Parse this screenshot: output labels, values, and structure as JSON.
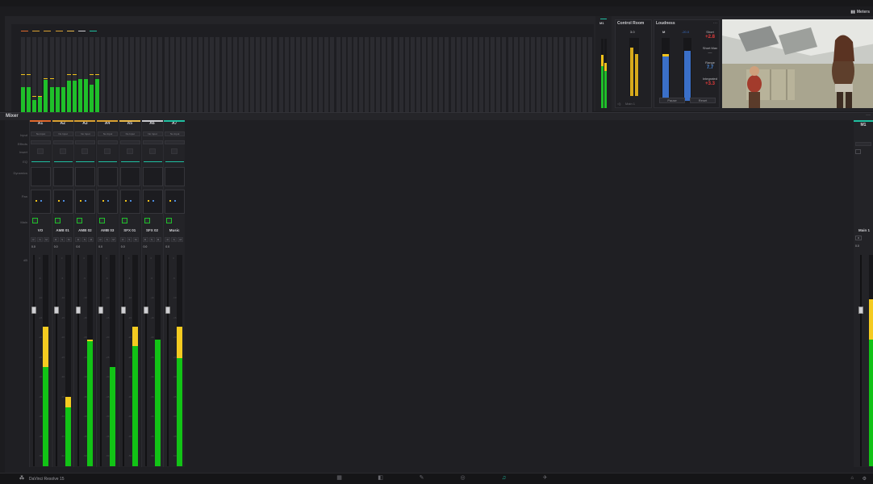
{
  "app": {
    "title": "DaVinci Resolve 15",
    "colors": {
      "meter_green": "#1fbf2a",
      "meter_yellow": "#f0c21a",
      "accent_blue": "#3a6fc8"
    }
  },
  "meters_panel": {
    "toggle_label": "Meters",
    "output_label": "M1",
    "control_room": {
      "title": "Control Room",
      "level": "3.0",
      "dim_label": "Main 1",
      "output_select": "MAIN 1"
    },
    "loudness": {
      "title": "Loudness",
      "m_label": "M",
      "target": "-20.0",
      "short_label": "Short",
      "short_value": "+2.8",
      "short_max_label": "Short Max",
      "short_max_value": "—",
      "range_label": "Range",
      "range_value": "7.7",
      "integrated_label": "Integrated",
      "integrated_value": "+3.3",
      "pause_label": "Pause",
      "reset_label": "Reset"
    }
  },
  "mixer": {
    "title": "Mixer",
    "menu_icon": "ellipsis-icon",
    "row_labels": {
      "input": "Input",
      "effects": "Effects",
      "insert": "Insert",
      "eq": "EQ",
      "dynamics": "Dynamics",
      "pan": "Pan",
      "main": "Main",
      "db": "dB"
    },
    "strips": [
      {
        "id": "A1",
        "name": "VO",
        "input": "No Input",
        "color": "#e0682b",
        "level": 0.47,
        "peak": 0.66,
        "level2": 0.47,
        "gain": "0.0"
      },
      {
        "id": "A2",
        "name": "AMB 01",
        "input": "No Input",
        "color": "#d9a031",
        "level": 0.28,
        "peak": 0.33,
        "level2": 0.33,
        "gain": "0.0"
      },
      {
        "id": "A3",
        "name": "AMB 02",
        "input": "No Input",
        "color": "#d9a031",
        "level": 0.59,
        "peak": 0.6,
        "level2": 0.48,
        "gain": "0.0"
      },
      {
        "id": "A4",
        "name": "AMB 03",
        "input": "No Input",
        "color": "#d9a031",
        "level": 0.47,
        "peak": 0.47,
        "level2": 0.47,
        "gain": "0.0"
      },
      {
        "id": "A5",
        "name": "SFX 01",
        "input": "No Input",
        "color": "#e8b84a",
        "level": 0.57,
        "peak": 0.66,
        "level2": 0.57,
        "gain": "0.0"
      },
      {
        "id": "A6",
        "name": "SFX 02",
        "input": "No Input",
        "color": "#c9c9cd",
        "level": 0.6,
        "peak": 0.6,
        "level2": 0.6,
        "gain": "0.0"
      },
      {
        "id": "A7",
        "name": "Music",
        "input": "No Input",
        "color": "#1fbfa0",
        "level": 0.51,
        "peak": 0.66,
        "level2": 0.6,
        "gain": "0.0"
      }
    ],
    "main_strip": {
      "id": "M1",
      "name": "Main 1",
      "gain": "0.0",
      "level": 0.6,
      "peak": 0.79
    },
    "db_ticks": [
      "0",
      "-5",
      "-10",
      "-15",
      "-20",
      "-25",
      "-30",
      "-35",
      "-40",
      "-45",
      "-50"
    ]
  },
  "bottom_bar": {
    "app_name": "DaVinci Resolve 15",
    "pages": [
      {
        "name": "media-page-icon",
        "glyph": "▦"
      },
      {
        "name": "edit-page-icon",
        "glyph": "◧"
      },
      {
        "name": "fusion-page-icon",
        "glyph": "✎"
      },
      {
        "name": "color-page-icon",
        "glyph": "◎"
      },
      {
        "name": "fairlight-page-icon",
        "glyph": "♫",
        "active": true
      },
      {
        "name": "deliver-page-icon",
        "glyph": "✈"
      }
    ]
  }
}
